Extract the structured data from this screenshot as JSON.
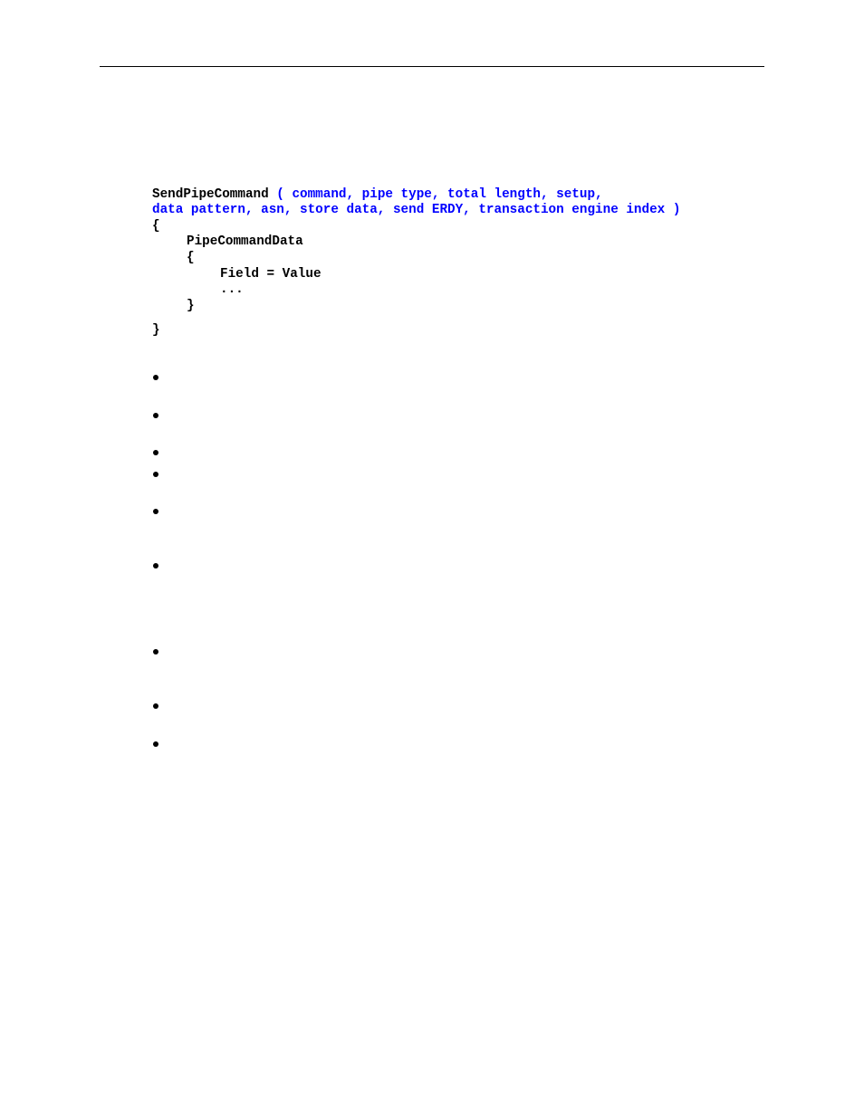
{
  "page": {
    "rule": "top-horizontal-rule"
  },
  "code": {
    "signature": {
      "function_name": "SendPipeCommand",
      "params_line1": " ( command, pipe type, total length, setup,",
      "params_line2": "data pattern, asn, store data, send ERDY, transaction engine index )"
    },
    "open_brace": "{",
    "inner_block_name": "PipeCommandData",
    "inner_open_brace": "{",
    "field_line": "Field = Value",
    "ellipsis": "...",
    "inner_close_brace": "}",
    "close_brace": "}"
  },
  "colors": {
    "keyword_text": "#000000",
    "parameter_text": "#0000ff"
  },
  "bullets": {
    "count": 9,
    "items": [
      "",
      "",
      "",
      "",
      "",
      "",
      "",
      "",
      ""
    ]
  }
}
